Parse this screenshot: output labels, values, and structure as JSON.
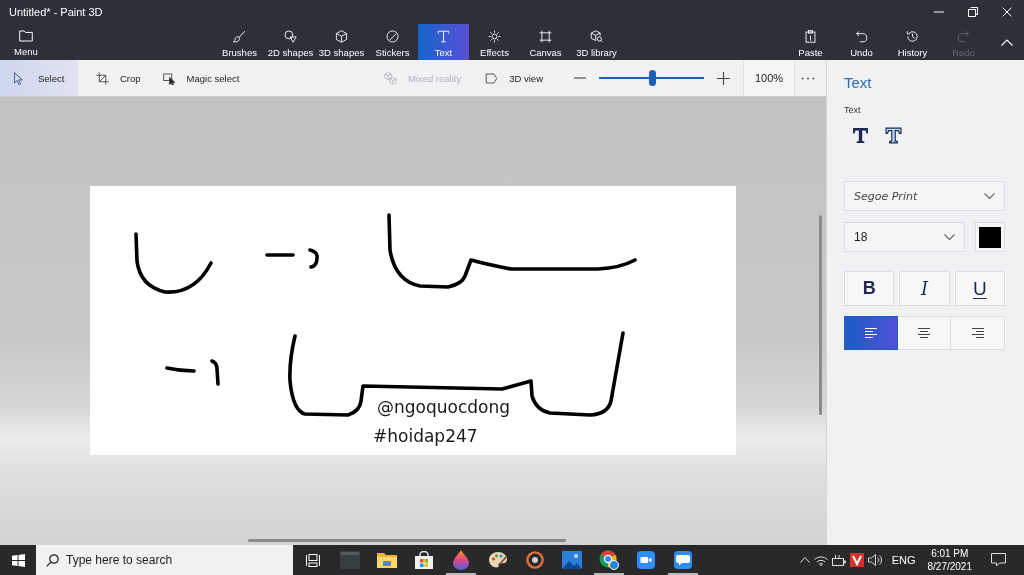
{
  "window": {
    "title": "Untitled* - Paint 3D"
  },
  "ribbon": {
    "menu": "Menu",
    "tools": [
      {
        "label": "Brushes",
        "selected": false
      },
      {
        "label": "2D shapes",
        "selected": false
      },
      {
        "label": "3D shapes",
        "selected": false
      },
      {
        "label": "Stickers",
        "selected": false
      },
      {
        "label": "Text",
        "selected": true
      },
      {
        "label": "Effects",
        "selected": false
      },
      {
        "label": "Canvas",
        "selected": false
      },
      {
        "label": "3D library",
        "selected": false
      }
    ],
    "actions": [
      {
        "label": "Paste",
        "disabled": false
      },
      {
        "label": "Undo",
        "disabled": false
      },
      {
        "label": "History",
        "disabled": false
      },
      {
        "label": "Redo",
        "disabled": true
      }
    ]
  },
  "toolbar": {
    "tools": [
      {
        "label": "Select",
        "selected": true,
        "disabled": false
      },
      {
        "label": "Crop",
        "selected": false,
        "disabled": false
      },
      {
        "label": "Magic select",
        "selected": false,
        "disabled": false
      },
      {
        "label": "Mixed reality",
        "selected": false,
        "disabled": true
      },
      {
        "label": "3D view",
        "selected": false,
        "disabled": false
      }
    ],
    "zoom": {
      "level": 0.5,
      "reading": "100%"
    }
  },
  "canvas": {
    "texts": [
      "@ngoquocdong",
      "#hoidap247"
    ]
  },
  "panel": {
    "title": "Text",
    "section": "Text",
    "font": "Segoe Print",
    "size": "18",
    "color": "#000000",
    "format": [
      {
        "label": "B",
        "kind": "bold",
        "on": false
      },
      {
        "label": "I",
        "kind": "italic",
        "on": false
      },
      {
        "label": "U",
        "kind": "underline",
        "on": false
      }
    ],
    "align": [
      {
        "kind": "left",
        "selected": true
      },
      {
        "kind": "center",
        "selected": false
      },
      {
        "kind": "right",
        "selected": false
      }
    ]
  },
  "taskbar": {
    "search": {
      "placeholder": "Type here to search"
    },
    "apps": [
      {
        "running": false
      },
      {
        "running": false
      },
      {
        "running": false
      },
      {
        "running": true
      },
      {
        "running": false
      },
      {
        "running": false
      },
      {
        "running": false
      },
      {
        "running": true
      },
      {
        "running": false
      },
      {
        "running": true
      }
    ],
    "tray": {
      "language": "ENG",
      "time": "6:01 PM",
      "date": "8/27/2021"
    }
  }
}
